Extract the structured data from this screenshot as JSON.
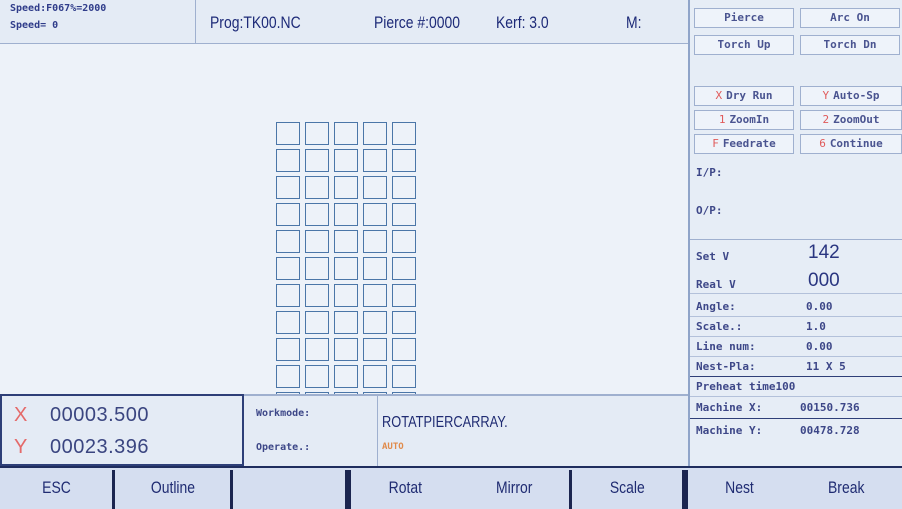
{
  "header": {
    "speed_line1": "Speed:F067%=2000",
    "speed_line2": "Speed= 0",
    "prog": "Prog:TK00.NC",
    "pierce": "Pierce #:0000",
    "kerf": "Kerf: 3.0",
    "m": "M:"
  },
  "drawing": {
    "columns": 5,
    "rows": 11
  },
  "right_panel": {
    "top_buttons": [
      "Pierce",
      "Arc On",
      "Torch Up",
      "Torch Dn"
    ],
    "func_buttons": [
      {
        "key": "X",
        "label": "Dry Run"
      },
      {
        "key": "Y",
        "label": "Auto-Sp"
      },
      {
        "key": "1",
        "label": "ZoomIn"
      },
      {
        "key": "2",
        "label": "ZoomOut"
      },
      {
        "key": "F",
        "label": "Feedrate"
      },
      {
        "key": "6",
        "label": "Continue"
      }
    ],
    "ip": "I/P:",
    "op": "O/P:",
    "set_v_label": "Set  V",
    "set_v": "142",
    "real_v_label": "Real V",
    "real_v": "000",
    "angle_label": "Angle:",
    "angle": "0.00",
    "scale_label": "Scale.:",
    "scale": "1.0",
    "line_num_label": "Line num:",
    "line_num": "0.00",
    "nest_pla_label": "Nest-Pla:",
    "nest_pla": "11 X 5",
    "preheat": "Preheat time100",
    "machine_x_label": "Machine X:",
    "machine_x": "00150.736",
    "machine_y_label": "Machine Y:",
    "machine_y": "00478.728"
  },
  "coords": {
    "x_label": "X",
    "x": "00003.500",
    "y_label": "Y",
    "y": "00023.396"
  },
  "workmode": {
    "workmode_label": "Workmode:",
    "workmode_value": "ROTATPIERCARRAY.",
    "operate_label": "Operate.:",
    "operate_value": "AUTO"
  },
  "toolbar": [
    "ESC",
    "Outline",
    "",
    "Rotat",
    "Mirror",
    "Scale",
    "Nest",
    "Break"
  ],
  "colors": {
    "text": "#2c3a78",
    "accent_red": "#e05a5a",
    "grid": "#4b76a8",
    "auto": "#e08a4a"
  }
}
